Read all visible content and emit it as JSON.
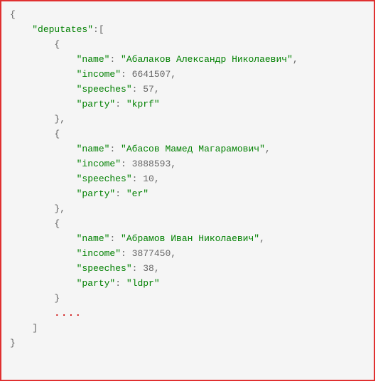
{
  "code": {
    "root_key": "\"deputates\"",
    "entries": [
      {
        "name_key": "\"name\"",
        "name_val": "\"Абалаков Александр Николаевич\"",
        "income_key": "\"income\"",
        "income_val": "6641507",
        "speeches_key": "\"speeches\"",
        "speeches_val": "57",
        "party_key": "\"party\"",
        "party_val": "\"kprf\""
      },
      {
        "name_key": "\"name\"",
        "name_val": "\"Абасов Мамед Магарамович\"",
        "income_key": "\"income\"",
        "income_val": "3888593",
        "speeches_key": "\"speeches\"",
        "speeches_val": "10",
        "party_key": "\"party\"",
        "party_val": "\"er\""
      },
      {
        "name_key": "\"name\"",
        "name_val": "\"Абрамов Иван Николаевич\"",
        "income_key": "\"income\"",
        "income_val": "3877450",
        "speeches_key": "\"speeches\"",
        "speeches_val": "38",
        "party_key": "\"party\"",
        "party_val": "\"ldpr\""
      }
    ],
    "ellipsis": "...."
  }
}
